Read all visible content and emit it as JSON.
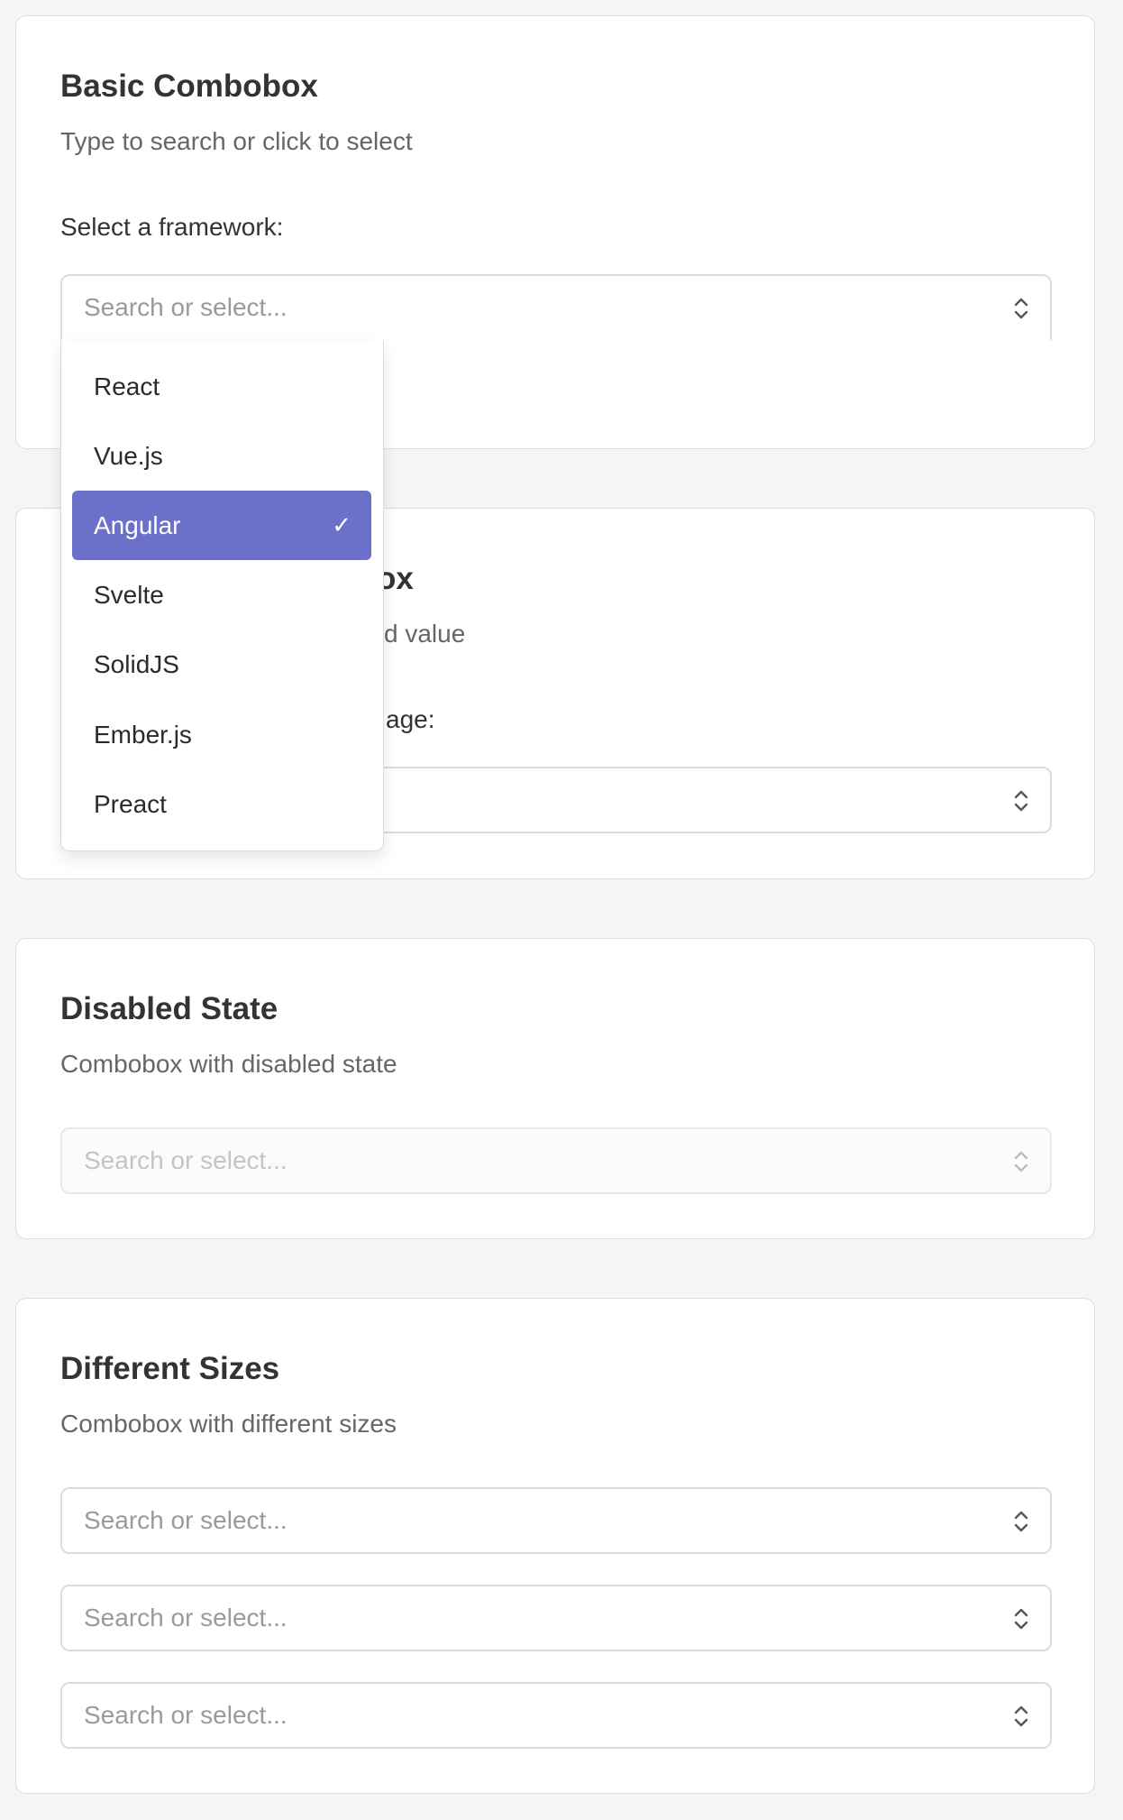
{
  "basic": {
    "title": "Basic Combobox",
    "description": "Type to search or click to select",
    "label": "Select a framework:",
    "placeholder": "Search or select...",
    "options": [
      {
        "label": "React"
      },
      {
        "label": "Vue.js"
      },
      {
        "label": "Angular",
        "selected": true
      },
      {
        "label": "Svelte"
      },
      {
        "label": "SolidJS"
      },
      {
        "label": "Ember.js"
      },
      {
        "label": "Preact"
      }
    ],
    "check_glyph": "✓"
  },
  "second": {
    "title_visible": "ox",
    "description_visible": "d value",
    "label_visible": "age:"
  },
  "disabled": {
    "title": "Disabled State",
    "description": "Combobox with disabled state",
    "placeholder": "Search or select..."
  },
  "sizes": {
    "title": "Different Sizes",
    "description": "Combobox with different sizes",
    "placeholders": [
      "Search or select...",
      "Search or select...",
      "Search or select..."
    ]
  },
  "colors": {
    "accent": "#6b70c8",
    "background": "#f5f5f5",
    "card": "#ffffff"
  },
  "icons": {
    "combo_indicator": "chevron-up-down-icon",
    "selected_indicator": "check-icon"
  }
}
